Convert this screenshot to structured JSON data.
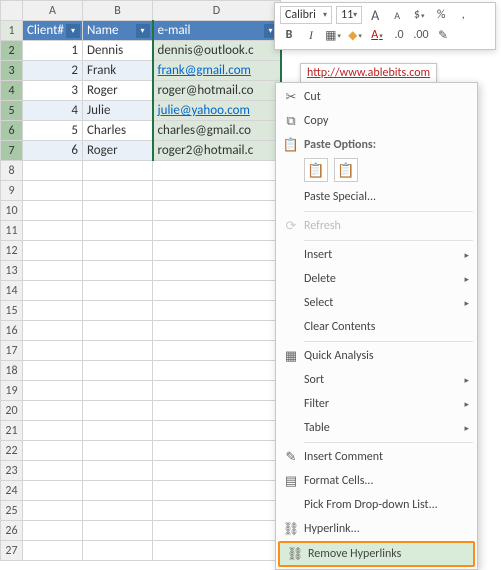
{
  "toolbar": {
    "font": "Calibri",
    "size": "11",
    "big_a": "A",
    "small_a": "A",
    "currency": "$",
    "percent": "%",
    "bold": "B",
    "italic": "I"
  },
  "url_popup": "http://www.ablebits.com",
  "columns": [
    "A",
    "B",
    "D"
  ],
  "headers": {
    "client": "Client#",
    "name": "Name",
    "email": "e-mail"
  },
  "rows": [
    {
      "n": "1"
    },
    {
      "n": "2",
      "id": "1",
      "name": "Dennis",
      "email": "dennis@outlook.c",
      "link": false,
      "band": false
    },
    {
      "n": "3",
      "id": "2",
      "name": "Frank",
      "email": "frank@gmail.com",
      "link": true,
      "band": true
    },
    {
      "n": "4",
      "id": "3",
      "name": "Roger",
      "email": "roger@hotmail.co",
      "link": false,
      "band": false
    },
    {
      "n": "5",
      "id": "4",
      "name": "Julie",
      "email": "julie@yahoo.com",
      "link": true,
      "band": true
    },
    {
      "n": "6",
      "id": "5",
      "name": "Charles",
      "email": "charles@gmail.co",
      "link": false,
      "band": false
    },
    {
      "n": "7",
      "id": "6",
      "name": "Roger",
      "email": "roger2@hotmail.c",
      "link": false,
      "band": true
    }
  ],
  "empty_rows": [
    "8",
    "9",
    "10",
    "11",
    "12",
    "13",
    "14",
    "15",
    "16",
    "17",
    "18",
    "19",
    "20",
    "21",
    "22",
    "23",
    "24",
    "25",
    "26",
    "27"
  ],
  "menu": {
    "cut": "Cut",
    "copy": "Copy",
    "paste_options": "Paste Options:",
    "paste_special": "Paste Special...",
    "refresh": "Refresh",
    "insert": "Insert",
    "delete": "Delete",
    "select": "Select",
    "clear_contents": "Clear Contents",
    "quick_analysis": "Quick Analysis",
    "sort": "Sort",
    "filter": "Filter",
    "table": "Table",
    "insert_comment": "Insert Comment",
    "format_cells": "Format Cells...",
    "pick_list": "Pick From Drop-down List...",
    "hyperlink": "Hyperlink...",
    "remove_hyperlinks": "Remove Hyperlinks"
  }
}
